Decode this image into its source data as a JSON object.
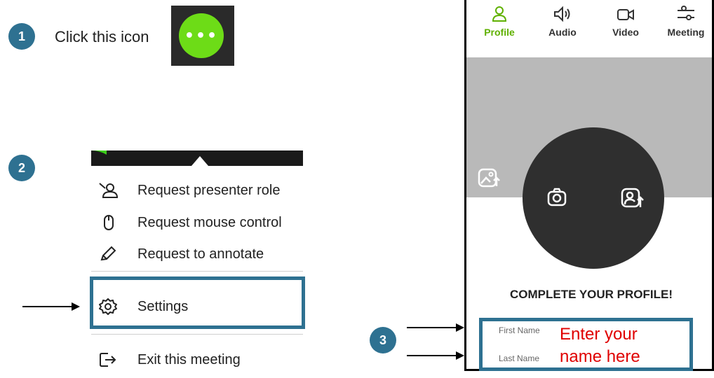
{
  "step1": {
    "number": "1",
    "text": "Click this icon",
    "button_glyph": "•••"
  },
  "step2": {
    "number": "2",
    "menu": [
      {
        "label": "Request presenter role",
        "icon": "presenter-icon"
      },
      {
        "label": "Request mouse control",
        "icon": "mouse-icon"
      },
      {
        "label": "Request to annotate",
        "icon": "pencil-icon"
      },
      {
        "label": "Settings",
        "icon": "gear-icon"
      },
      {
        "label": "Exit this meeting",
        "icon": "exit-icon"
      }
    ]
  },
  "step3": {
    "number": "3",
    "tabs": [
      {
        "label": "Profile",
        "icon": "person-icon"
      },
      {
        "label": "Audio",
        "icon": "speaker-icon"
      },
      {
        "label": "Video",
        "icon": "camera-icon"
      },
      {
        "label": "Meeting",
        "icon": "sliders-icon"
      }
    ],
    "heading": "COMPLETE YOUR PROFILE!",
    "first_name_label": "First Name",
    "last_name_label": "Last Name",
    "note_line1": "Enter your",
    "note_line2": "name here"
  },
  "colors": {
    "accent_green": "#5fb000",
    "badge_blue": "#2e7191",
    "note_red": "#e00000"
  }
}
